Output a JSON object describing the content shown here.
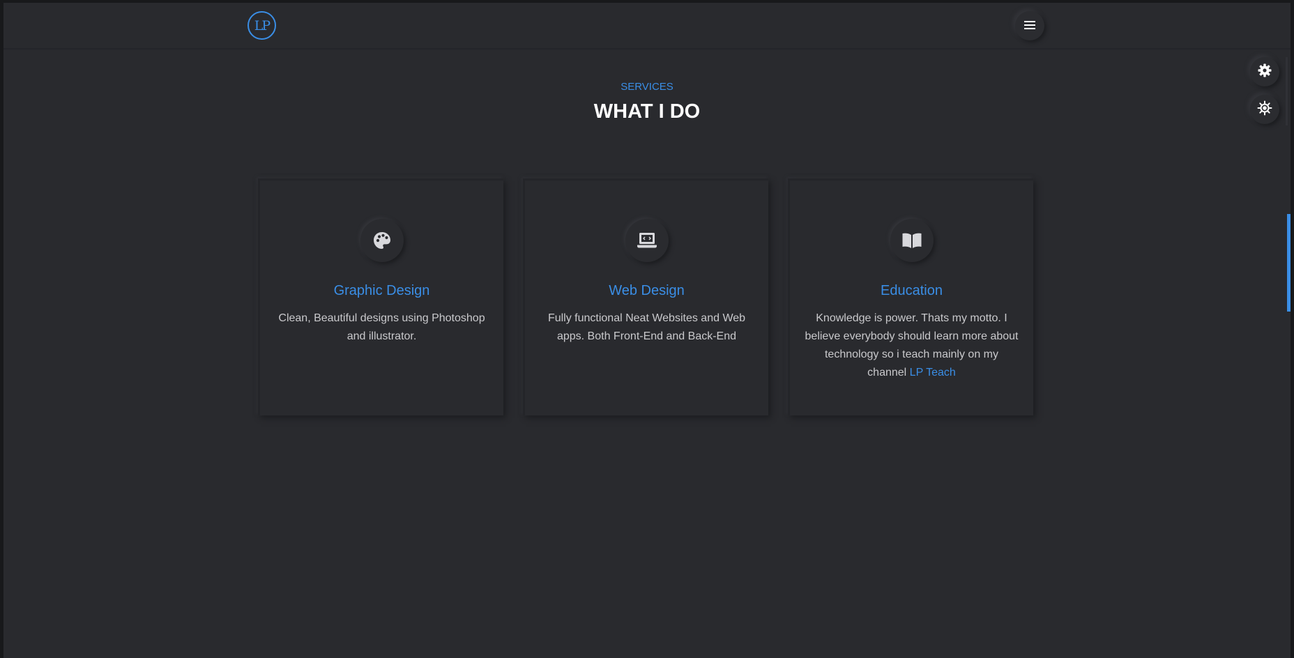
{
  "header": {
    "logo_text": "LP",
    "menu_icon": "hamburger-icon"
  },
  "side_controls": {
    "settings_icon": "gear-icon",
    "theme_icon": "sun-icon"
  },
  "services": {
    "subtitle": "SERVICES",
    "title": "WHAT I DO",
    "cards": [
      {
        "icon": "palette-icon",
        "title": "Graphic Design",
        "text": "Clean, Beautiful designs using Photoshop and illustrator."
      },
      {
        "icon": "laptop-code-icon",
        "title": "Web Design",
        "text": "Fully functional Neat Websites and Web apps. Both Front-End and Back-End"
      },
      {
        "icon": "book-open-icon",
        "title": "Education",
        "text": "Knowledge is power. Thats my motto. I believe everybody should learn more about technology so i teach mainly on my channel",
        "link_text": "LP Teach"
      }
    ]
  },
  "colors": {
    "accent": "#3a8ee6",
    "background": "#292a2e",
    "text": "#c9c9cc",
    "heading": "#ffffff"
  }
}
